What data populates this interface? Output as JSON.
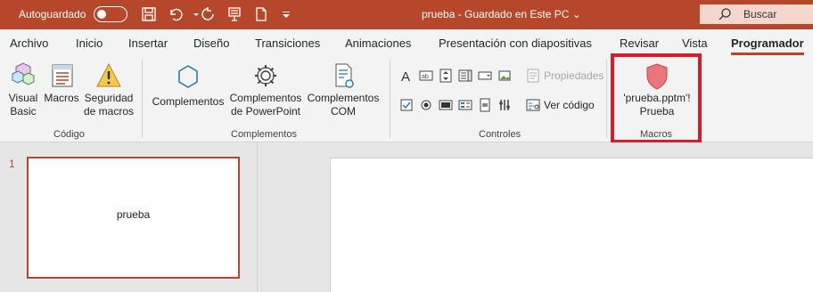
{
  "titlebar": {
    "autosave_label": "Autoguardado",
    "autosave_state": "off",
    "document_title": "prueba  -  Guardado en Este PC  ⌄",
    "search_placeholder": "Buscar",
    "icons": [
      "save-icon",
      "undo-icon",
      "redo-icon",
      "presentation-icon",
      "new-file-icon",
      "customize-icon"
    ]
  },
  "tabs": [
    {
      "label": "Archivo"
    },
    {
      "label": "Inicio"
    },
    {
      "label": "Insertar"
    },
    {
      "label": "Diseño"
    },
    {
      "label": "Transiciones"
    },
    {
      "label": "Animaciones"
    },
    {
      "label": "Presentación con diapositivas"
    },
    {
      "label": "Revisar"
    },
    {
      "label": "Vista"
    },
    {
      "label": "Programador",
      "active": true
    }
  ],
  "ribbon": {
    "codigo": {
      "label": "Código",
      "visual_basic": [
        "Visual",
        "Basic"
      ],
      "macros": "Macros",
      "seguridad": [
        "Seguridad",
        "de macros"
      ]
    },
    "complementos": {
      "label": "Complementos",
      "complementos": "Complementos",
      "complementos_ppt": [
        "Complementos",
        "de PowerPoint"
      ],
      "complementos_com": [
        "Complementos",
        "COM"
      ]
    },
    "controles": {
      "label": "Controles",
      "propiedades": "Propiedades",
      "ver_codigo": "Ver código"
    },
    "macros": {
      "label": "Macros",
      "button": [
        "'prueba.pptm'!",
        "Prueba"
      ]
    }
  },
  "slides_panel": {
    "slide_number": "1",
    "thumb_text": "prueba"
  },
  "colors": {
    "accent": "#b7472a",
    "highlight": "#d21f2b"
  }
}
